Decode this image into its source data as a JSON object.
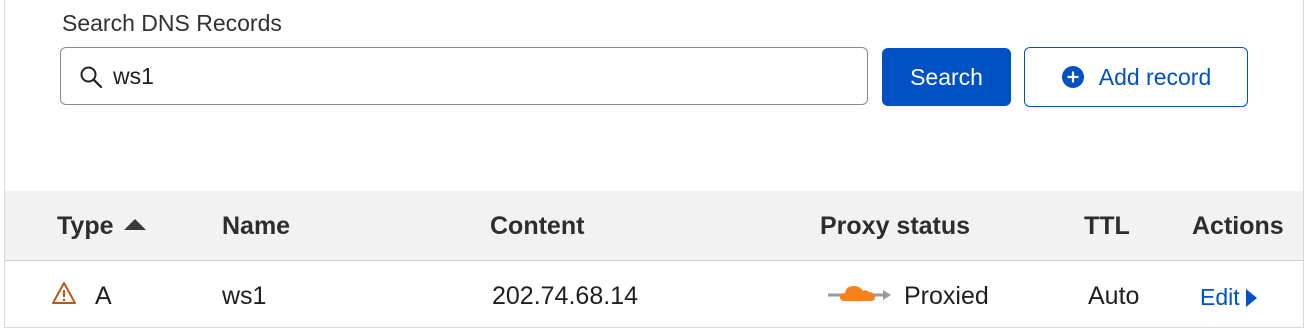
{
  "search": {
    "label": "Search DNS Records",
    "value": "ws1",
    "placeholder": "",
    "button_label": "Search",
    "icon": "search-icon"
  },
  "actions": {
    "add_record_label": "Add record",
    "add_icon": "plus-circle-icon"
  },
  "table": {
    "headers": [
      "Type",
      "Name",
      "Content",
      "Proxy status",
      "TTL",
      "Actions"
    ],
    "rows": [
      {
        "type": "A",
        "type_icon": "warning-icon",
        "name": "ws1",
        "content": "202.74.68.14",
        "proxy_status": "Proxied",
        "proxy_icon": "cloud-proxied-icon",
        "ttl": "Auto",
        "action": "Edit"
      }
    ],
    "sorted_by": "Type",
    "sort_direction": "ascending"
  },
  "colors": {
    "primary": "#0051c3",
    "warning": "#b75a12",
    "cloud": "#f6821f",
    "header_bg": "#f2f2f2"
  }
}
